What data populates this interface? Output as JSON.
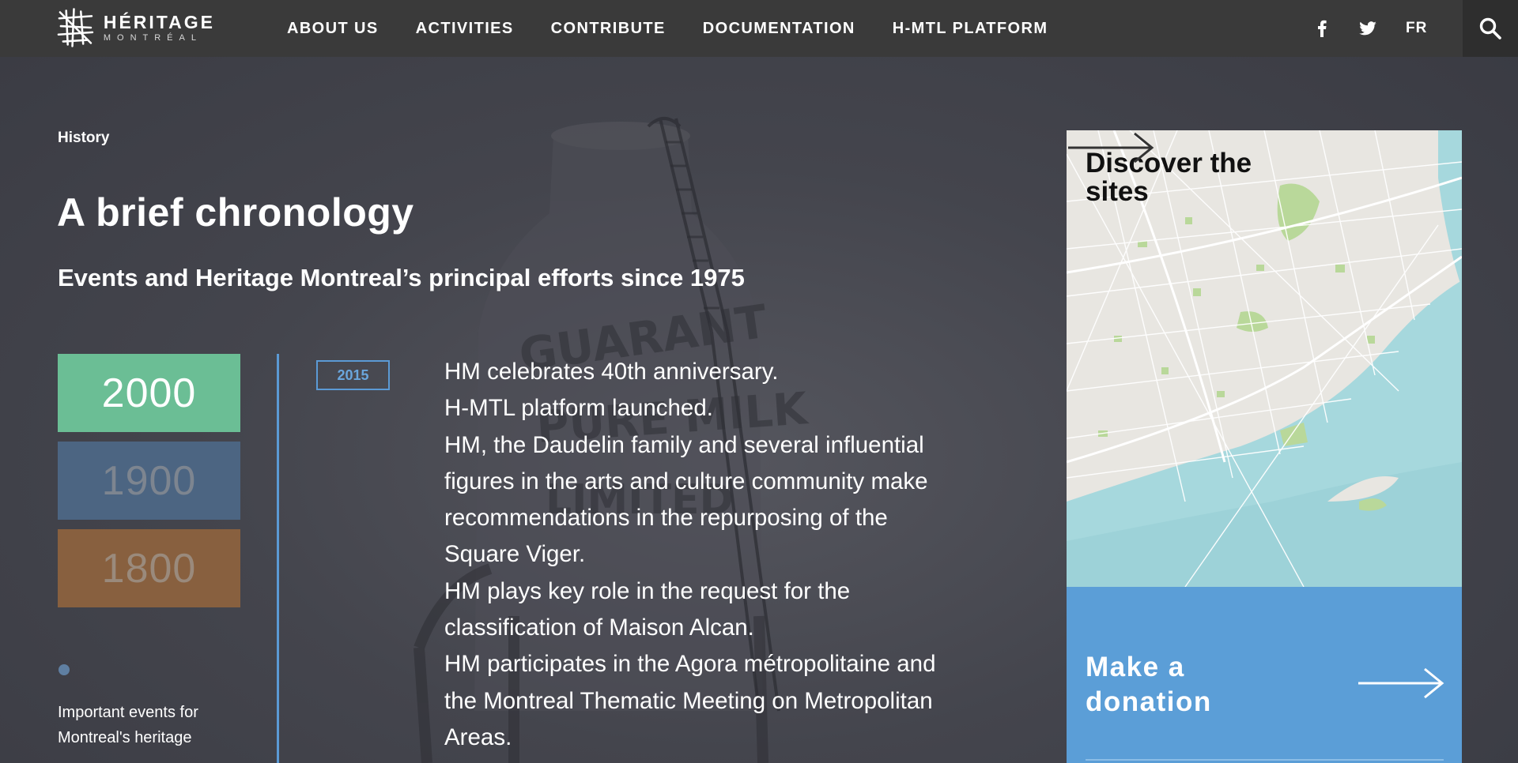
{
  "brand": {
    "name": "HÉRITAGE",
    "city": "MONTRÉAL"
  },
  "nav": {
    "items": [
      {
        "label": "ABOUT US"
      },
      {
        "label": "ACTIVITIES"
      },
      {
        "label": "CONTRIBUTE"
      },
      {
        "label": "DOCUMENTATION"
      },
      {
        "label": "H-MTL PLATFORM"
      }
    ],
    "social": [
      {
        "icon": "facebook-icon"
      },
      {
        "icon": "twitter-icon"
      }
    ],
    "language": "FR",
    "search_icon": "search-icon"
  },
  "page": {
    "breadcrumb": "History",
    "title": "A brief chronology",
    "subtitle": "Events and Heritage Montreal’s principal efforts since 1975"
  },
  "eras": [
    {
      "label": "2000",
      "active": true,
      "color": "#6bbe95"
    },
    {
      "label": "1900",
      "active": false,
      "color": "#4c6582"
    },
    {
      "label": "1800",
      "active": false,
      "color": "#88603f"
    }
  ],
  "legend": {
    "dot_color": "#5f7fa2",
    "text": "Important events for Montreal's heritage"
  },
  "timeline": {
    "accent": "#5b9ad5",
    "year": "2015",
    "events": [
      "HM celebrates 40th anniversary.",
      "H-MTL platform launched.",
      "HM, the Daudelin family and several influential figures in the arts and culture community make recommendations in the repurposing of the Square Viger.",
      "HM plays key role in the request for the classification of Maison Alcan.",
      "HM participates in the Agora métropolitaine and the Montreal Thematic Meeting on Metropolitan Areas."
    ]
  },
  "cards": {
    "map": {
      "title": "Discover the sites",
      "arrow_icon": "arrow-right-icon"
    },
    "donate": {
      "title": "Make a donation",
      "arrow_icon": "arrow-right-icon",
      "color": "#5b9ed7"
    }
  }
}
